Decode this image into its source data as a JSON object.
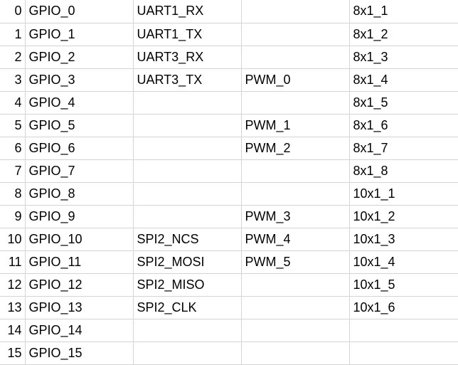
{
  "rows": [
    {
      "idx": "0",
      "gpio": "GPIO_0",
      "func": "UART1_RX",
      "pwm": "",
      "conn": "8x1_1"
    },
    {
      "idx": "1",
      "gpio": "GPIO_1",
      "func": "UART1_TX",
      "pwm": "",
      "conn": "8x1_2"
    },
    {
      "idx": "2",
      "gpio": "GPIO_2",
      "func": "UART3_RX",
      "pwm": "",
      "conn": "8x1_3"
    },
    {
      "idx": "3",
      "gpio": "GPIO_3",
      "func": "UART3_TX",
      "pwm": "PWM_0",
      "conn": "8x1_4"
    },
    {
      "idx": "4",
      "gpio": "GPIO_4",
      "func": "",
      "pwm": "",
      "conn": "8x1_5"
    },
    {
      "idx": "5",
      "gpio": "GPIO_5",
      "func": "",
      "pwm": "PWM_1",
      "conn": "8x1_6"
    },
    {
      "idx": "6",
      "gpio": "GPIO_6",
      "func": "",
      "pwm": "PWM_2",
      "conn": "8x1_7"
    },
    {
      "idx": "7",
      "gpio": "GPIO_7",
      "func": "",
      "pwm": "",
      "conn": "8x1_8"
    },
    {
      "idx": "8",
      "gpio": "GPIO_8",
      "func": "",
      "pwm": "",
      "conn": "10x1_1"
    },
    {
      "idx": "9",
      "gpio": "GPIO_9",
      "func": "",
      "pwm": "PWM_3",
      "conn": "10x1_2"
    },
    {
      "idx": "10",
      "gpio": "GPIO_10",
      "func": "SPI2_NCS",
      "pwm": "PWM_4",
      "conn": "10x1_3"
    },
    {
      "idx": "11",
      "gpio": "GPIO_11",
      "func": "SPI2_MOSI",
      "pwm": "PWM_5",
      "conn": "10x1_4"
    },
    {
      "idx": "12",
      "gpio": "GPIO_12",
      "func": "SPI2_MISO",
      "pwm": "",
      "conn": "10x1_5"
    },
    {
      "idx": "13",
      "gpio": "GPIO_13",
      "func": "SPI2_CLK",
      "pwm": "",
      "conn": "10x1_6"
    },
    {
      "idx": "14",
      "gpio": "GPIO_14",
      "func": "",
      "pwm": "",
      "conn": ""
    },
    {
      "idx": "15",
      "gpio": "GPIO_15",
      "func": "",
      "pwm": "",
      "conn": ""
    }
  ]
}
